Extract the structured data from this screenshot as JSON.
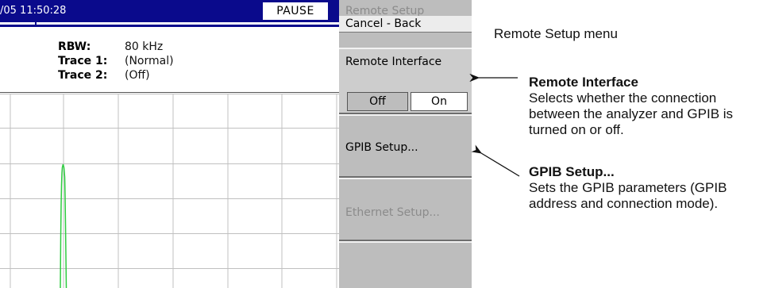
{
  "screen": {
    "datetime": "/05 11:50:28",
    "status_badge": "PAUSE",
    "params": [
      {
        "label": "RBW:",
        "value": "80 kHz"
      },
      {
        "label": "Trace 1:",
        "value": "(Normal)"
      },
      {
        "label": "Trace 2:",
        "value": "(Off)"
      }
    ],
    "grid_color": "#c0c0c0",
    "trace_color": "#2ecc40"
  },
  "menu": {
    "title": "Remote Setup",
    "cancel_back": "Cancel - Back",
    "remote_interface": {
      "label": "Remote Interface",
      "options": [
        "Off",
        "On"
      ],
      "selected": "On"
    },
    "gpib_setup": "GPIB Setup...",
    "ethernet_setup": "Ethernet Setup..."
  },
  "callouts": {
    "menu_label": "Remote Setup menu",
    "remote_interface_title": "Remote Interface",
    "remote_interface_desc": "Selects whether the connection between the analyzer and GPIB is turned on or off.",
    "gpib_title": "GPIB Setup...",
    "gpib_desc": "Sets the GPIB parameters (GPIB address and connection mode)."
  }
}
